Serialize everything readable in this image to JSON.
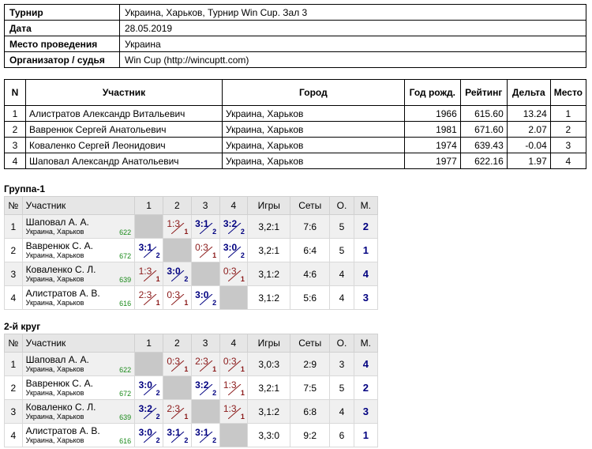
{
  "info": [
    {
      "key": "Турнир",
      "value": "Украина, Харьков, Турнир Win Cup. Зал 3"
    },
    {
      "key": "Дата",
      "value": "28.05.2019"
    },
    {
      "key": "Место проведения",
      "value": "Украина"
    },
    {
      "key": "Организатор / судья",
      "value": "Win Cup (http://wincuptt.com)"
    }
  ],
  "participants": {
    "headers": [
      "N",
      "Участник",
      "Город",
      "Год рожд.",
      "Рейтинг",
      "Дельта",
      "Место"
    ],
    "rows": [
      {
        "n": "1",
        "name": "Алистратов Александр Витальевич",
        "city": "Украина, Харьков",
        "year": "1966",
        "rating": "615.60",
        "delta": "13.24",
        "place": "1"
      },
      {
        "n": "2",
        "name": "Вавренюк Сергей Анатольевич",
        "city": "Украина, Харьков",
        "year": "1981",
        "rating": "671.60",
        "delta": "2.07",
        "place": "2"
      },
      {
        "n": "3",
        "name": "Коваленко Сергей Леонидович",
        "city": "Украина, Харьков",
        "year": "1974",
        "rating": "639.43",
        "delta": "-0.04",
        "place": "3"
      },
      {
        "n": "4",
        "name": "Шаповал Александр Анатольевич",
        "city": "Украина, Харьков",
        "year": "1977",
        "rating": "622.16",
        "delta": "1.97",
        "place": "4"
      }
    ]
  },
  "groups": [
    {
      "title": "Группа-1",
      "headers": [
        "№",
        "Участник",
        "1",
        "2",
        "3",
        "4",
        "Игры",
        "Сеты",
        "О.",
        "М."
      ],
      "rows": [
        {
          "n": "1",
          "name": "Шаповал А. А.",
          "city": "Украина, Харьков",
          "rating": "622",
          "results": [
            null,
            {
              "s": "1:3",
              "p": "1",
              "w": false
            },
            {
              "s": "3:1",
              "p": "2",
              "w": true
            },
            {
              "s": "3:2",
              "p": "2",
              "w": true
            }
          ],
          "games": "3,2:1",
          "sets": "7:6",
          "points": "5",
          "place": "2"
        },
        {
          "n": "2",
          "name": "Вавренюк С. А.",
          "city": "Украина, Харьков",
          "rating": "672",
          "results": [
            {
              "s": "3:1",
              "p": "2",
              "w": true
            },
            null,
            {
              "s": "0:3",
              "p": "1",
              "w": false
            },
            {
              "s": "3:0",
              "p": "2",
              "w": true
            }
          ],
          "games": "3,2:1",
          "sets": "6:4",
          "points": "5",
          "place": "1"
        },
        {
          "n": "3",
          "name": "Коваленко С. Л.",
          "city": "Украина, Харьков",
          "rating": "639",
          "results": [
            {
              "s": "1:3",
              "p": "1",
              "w": false
            },
            {
              "s": "3:0",
              "p": "2",
              "w": true
            },
            null,
            {
              "s": "0:3",
              "p": "1",
              "w": false
            }
          ],
          "games": "3,1:2",
          "sets": "4:6",
          "points": "4",
          "place": "4"
        },
        {
          "n": "4",
          "name": "Алистратов А. В.",
          "city": "Украина, Харьков",
          "rating": "616",
          "results": [
            {
              "s": "2:3",
              "p": "1",
              "w": false
            },
            {
              "s": "0:3",
              "p": "1",
              "w": false
            },
            {
              "s": "3:0",
              "p": "2",
              "w": true
            },
            null
          ],
          "games": "3,1:2",
          "sets": "5:6",
          "points": "4",
          "place": "3"
        }
      ]
    },
    {
      "title": "2-й круг",
      "headers": [
        "№",
        "Участник",
        "1",
        "2",
        "3",
        "4",
        "Игры",
        "Сеты",
        "О.",
        "М."
      ],
      "rows": [
        {
          "n": "1",
          "name": "Шаповал А. А.",
          "city": "Украина, Харьков",
          "rating": "622",
          "results": [
            null,
            {
              "s": "0:3",
              "p": "1",
              "w": false
            },
            {
              "s": "2:3",
              "p": "1",
              "w": false
            },
            {
              "s": "0:3",
              "p": "1",
              "w": false
            }
          ],
          "games": "3,0:3",
          "sets": "2:9",
          "points": "3",
          "place": "4"
        },
        {
          "n": "2",
          "name": "Вавренюк С. А.",
          "city": "Украина, Харьков",
          "rating": "672",
          "results": [
            {
              "s": "3:0",
              "p": "2",
              "w": true
            },
            null,
            {
              "s": "3:2",
              "p": "2",
              "w": true
            },
            {
              "s": "1:3",
              "p": "1",
              "w": false
            }
          ],
          "games": "3,2:1",
          "sets": "7:5",
          "points": "5",
          "place": "2"
        },
        {
          "n": "3",
          "name": "Коваленко С. Л.",
          "city": "Украина, Харьков",
          "rating": "639",
          "results": [
            {
              "s": "3:2",
              "p": "2",
              "w": true
            },
            {
              "s": "2:3",
              "p": "1",
              "w": false
            },
            null,
            {
              "s": "1:3",
              "p": "1",
              "w": false
            }
          ],
          "games": "3,1:2",
          "sets": "6:8",
          "points": "4",
          "place": "3"
        },
        {
          "n": "4",
          "name": "Алистратов А. В.",
          "city": "Украина, Харьков",
          "rating": "616",
          "results": [
            {
              "s": "3:0",
              "p": "2",
              "w": true
            },
            {
              "s": "3:1",
              "p": "2",
              "w": true
            },
            {
              "s": "3:1",
              "p": "2",
              "w": true
            },
            null
          ],
          "games": "3,3:0",
          "sets": "9:2",
          "points": "6",
          "place": "1"
        }
      ]
    }
  ]
}
